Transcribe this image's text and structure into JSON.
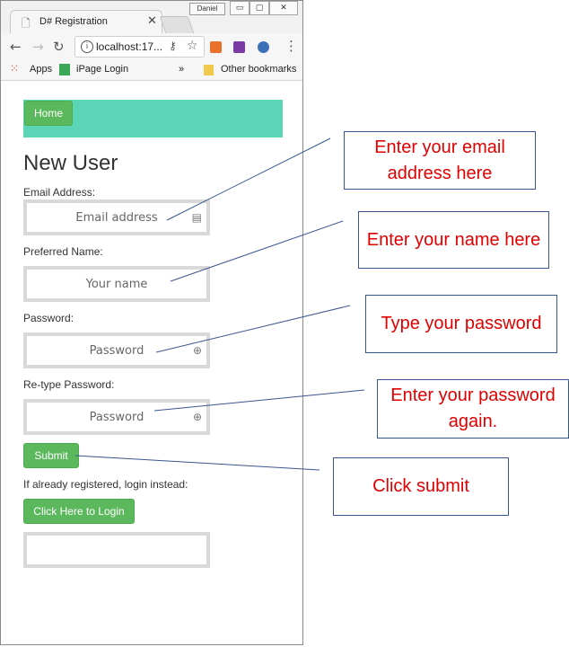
{
  "browser": {
    "tab_title": "D# Registration",
    "user_chip": "Daniel",
    "url": "localhost:17...",
    "bookmarks": {
      "apps": "Apps",
      "ipage": "iPage Login",
      "more": "»",
      "other": "Other bookmarks"
    }
  },
  "page": {
    "nav_home": "Home",
    "title": "New User",
    "email_label": "Email Address:",
    "email_placeholder": "Email address",
    "name_label": "Preferred Name:",
    "name_placeholder": "Your name",
    "password_label": "Password:",
    "password_placeholder": "Password",
    "retype_label": "Re-type Password:",
    "retype_placeholder": "Password",
    "submit": "Submit",
    "login_text": "If already registered, login instead:",
    "login_button": "Click Here to Login"
  },
  "callouts": {
    "email": "Enter your email address here",
    "name": "Enter your name here",
    "password": "Type your password",
    "retype": "Enter your password again.",
    "submit": "Click submit"
  },
  "colors": {
    "navbar": "#5bd5b6",
    "button": "#5cb85c",
    "callout_text": "#e00000",
    "callout_border": "#3a5690"
  }
}
